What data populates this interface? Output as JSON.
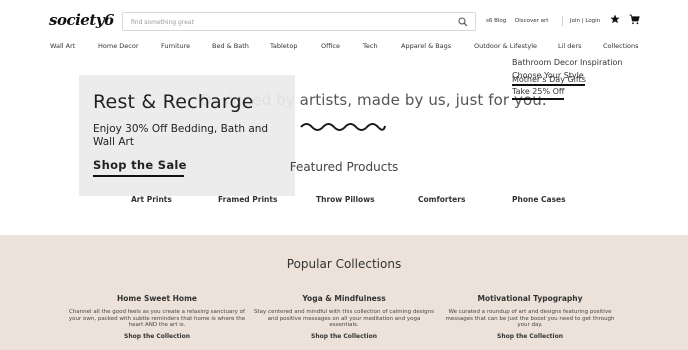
{
  "header": {
    "logo": "society6",
    "search_placeholder": "find something great",
    "links": [
      "s6 Blog",
      "Discover art",
      "Join | Login"
    ]
  },
  "nav": [
    "Wall Art",
    "Home Decor",
    "Furniture",
    "Bed & Bath",
    "Tabletop",
    "Office",
    "Tech",
    "Apparel & Bags",
    "Outdoor & Lifestyle",
    "Lil ders",
    "Collections"
  ],
  "dropdown": {
    "items": [
      "Bathroom Decor Inspiration",
      "Choose Your Style",
      "Mother's Day Gifts",
      "Take 25% Off"
    ]
  },
  "hero": {
    "tagline": "Designed by artists, made by us, just for you."
  },
  "promo": {
    "title": "Rest & Recharge",
    "subtitle": "Enjoy 30% Off Bedding, Bath and Wall Art",
    "cta": "Shop the Sale"
  },
  "featured": {
    "title": "Featured Products",
    "categories": [
      "Art Prints",
      "Framed Prints",
      "Throw Pillows",
      "Comforters",
      "Phone Cases"
    ]
  },
  "popular": {
    "title": "Popular Collections",
    "collections": [
      {
        "title": "Home Sweet Home",
        "desc": "Channel all the good feels as you create a relaxing sanctuary of your own, packed with subtle reminders that home is where the heart AND the art is.",
        "link": "Shop the Collection"
      },
      {
        "title": "Yoga & Mindfulness",
        "desc": "Stay centered and mindful with this collection of calming designs and positive messages on all your meditation and yoga essentials.",
        "link": "Shop the Collection"
      },
      {
        "title": "Motivational Typography",
        "desc": "We curated a roundup of art and designs featuring positive messages that can be just the boost you need to get through your day.",
        "link": "Shop the Collection"
      }
    ]
  },
  "colors": {
    "popular_background": "#ece2d9",
    "promo_background": "#ebebeb",
    "text": "#1a1a1a"
  },
  "icons": [
    "search-icon",
    "star-icon",
    "cart-icon"
  ]
}
